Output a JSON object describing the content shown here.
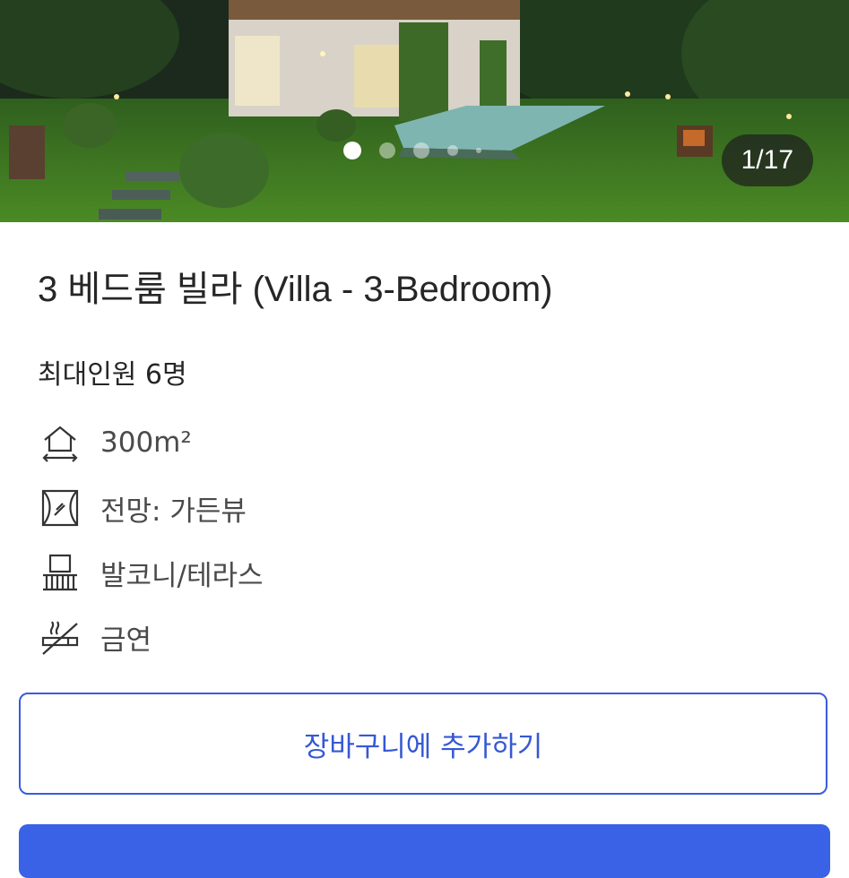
{
  "gallery": {
    "counter": "1/17",
    "current": 1,
    "total": 17,
    "dot_count": 5
  },
  "room": {
    "title": "3 베드룸 빌라 (Villa - 3-Bedroom)",
    "capacity": "최대인원 6명"
  },
  "features": [
    {
      "icon": "area-house-icon",
      "label": "300m²"
    },
    {
      "icon": "window-view-icon",
      "label": "전망: 가든뷰"
    },
    {
      "icon": "balcony-icon",
      "label": "발코니/테라스"
    },
    {
      "icon": "no-smoking-icon",
      "label": "금연"
    }
  ],
  "actions": {
    "add_to_cart": "장바구니에 추가하기"
  },
  "colors": {
    "accent": "#3558d4",
    "primary_button": "#3a62e6"
  }
}
